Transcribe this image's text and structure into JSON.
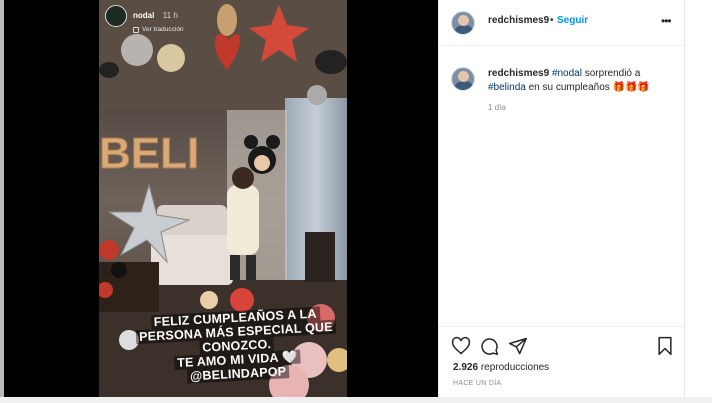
{
  "story": {
    "username": "nodal",
    "time": "11 h",
    "translate_label": "Ver traducción",
    "caption_lines": [
      "FELIZ CUMPLEAÑOS A LA",
      "PERSONA MÁS ESPECIAL QUE",
      "CONOZCO.",
      "TE AMO MI VIDA 🤍",
      "@BELINDAPOP"
    ],
    "balloon_letters": "BELI"
  },
  "post": {
    "header": {
      "username": "redchismes9",
      "separator": "•",
      "follow_label": "Seguir",
      "more_icon": "more-horizontal-icon"
    },
    "comment": {
      "username": "redchismes9",
      "tag1": "#nodal",
      "text1": " sorprendió a ",
      "tag2": "#belinda",
      "text2": " en su cumpleaños ",
      "emoji": "🎁🎁🎁",
      "time": "1 día"
    },
    "actions": {
      "like_icon": "heart-icon",
      "comment_icon": "comment-icon",
      "share_icon": "send-icon",
      "save_icon": "bookmark-icon"
    },
    "views_count": "2.926",
    "views_label": "reproducciones",
    "posted_label": "HACE UN DÍA"
  }
}
